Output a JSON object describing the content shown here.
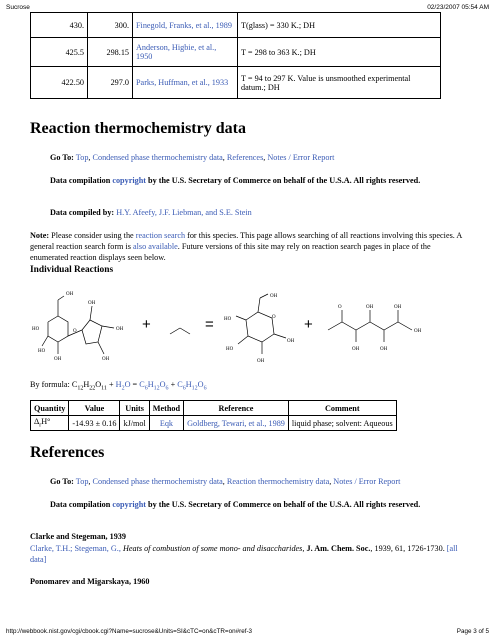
{
  "header": {
    "title": "Sucrose",
    "datetime": "02/23/2007 05:54 AM"
  },
  "footer": {
    "url": "http://webbook.nist.gov/cgi/cbook.cgi?Name=sucrose&Units=SI&cTC=on&cTR=on#ref-3",
    "page": "Page 3 of 5"
  },
  "heat_capacity_rows": [
    {
      "temp": "430.",
      "cp": "300.",
      "ref": "Finegold, Franks, et al., 1989",
      "comment": "T(glass) = 330 K.; DH"
    },
    {
      "temp": "425.5",
      "cp": "298.15",
      "ref": "Anderson, Higbie, et al., 1950",
      "comment": "T = 298 to 363 K.; DH"
    },
    {
      "temp": "422.50",
      "cp": "297.0",
      "ref": "Parks, Huffman, et al., 1933",
      "comment": "T = 94 to 297 K. Value is unsmoothed experimental datum.; DH"
    }
  ],
  "reaction_section": {
    "heading": "Reaction thermochemistry data",
    "goto_label": "Go To:",
    "goto_links": [
      "Top",
      "Condensed phase thermochemistry data",
      "References",
      "Notes / Error Report"
    ],
    "compilation_pre": "Data compilation",
    "copyright": "copyright",
    "compilation_post": "by the U.S. Secretary of Commerce on behalf of the U.S.A. All rights reserved.",
    "compiled_by_label": "Data compiled by:",
    "compiled_by": "H.Y. Afeefy, J.F. Liebman, and S.E. Stein",
    "note_label": "Note:",
    "note_1": "Please consider using the",
    "note_link_1": "reaction search",
    "note_2": "for this species. This page allows searching of all reactions involving this species. A general reaction search form is",
    "note_link_2": "also available",
    "note_3": ". Future versions of this site may rely on reaction search pages in place of the enumerated reaction displays seen below.",
    "individual_heading": "Individual Reactions",
    "plus_1": "+",
    "equals": "=",
    "plus_2": "+",
    "by_formula_label": "By formula:",
    "table_headers": [
      "Quantity",
      "Value",
      "Units",
      "Method",
      "Reference",
      "Comment"
    ],
    "table_row": {
      "quantity": "Δ",
      "value": "-14.93 ± 0.16",
      "units": "kJ/mol",
      "method": "Eqk",
      "reference": "Goldberg, Tewari, et al., 1989",
      "comment": "liquid phase; solvent: Aqueous"
    }
  },
  "references_section": {
    "heading": "References",
    "goto_label": "Go To:",
    "goto_links": [
      "Top",
      "Condensed phase thermochemistry data",
      "Reaction thermochemistry data",
      "Notes / Error Report"
    ],
    "compilation_pre": "Data compilation",
    "copyright": "copyright",
    "compilation_post": "by the U.S. Secretary of Commerce on behalf of the U.S.A. All rights reserved.",
    "ref1_title": "Clarke and Stegeman, 1939",
    "ref1_authors": "Clarke, T.H.; Stegeman, G.,",
    "ref1_article": "Heats of combustion of some mono- and disaccharides",
    "ref1_journal": "J. Am. Chem. Soc.",
    "ref1_details": ", 1939, 61, 1726-1730.",
    "ref1_all": "[all data]",
    "ref2_title": "Ponomarev and Migarskaya, 1960"
  }
}
